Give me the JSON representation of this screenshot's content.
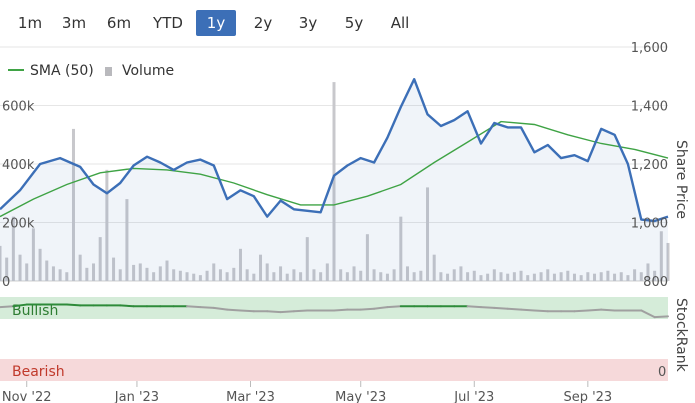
{
  "range_selector": {
    "buttons": [
      "1m",
      "3m",
      "6m",
      "YTD",
      "1y",
      "2y",
      "3y",
      "5y",
      "All"
    ],
    "active": "1y"
  },
  "legend": {
    "sma_label": "SMA (50)",
    "volume_label": "Volume"
  },
  "side_labels": {
    "price_axis": "Share Price",
    "rank_axis": "StockRank"
  },
  "zones": {
    "bullish": "Bullish",
    "bearish": "Bearish",
    "rank_zero": "0"
  },
  "colors": {
    "price_line": "#3c6fb7",
    "sma_line": "#3fa345",
    "volume_bar": "#c8c8cc",
    "bullish_fill": "#d5ecd9",
    "bearish_fill": "#f6d9da",
    "rank_bullish_line": "#2e8b3a",
    "rank_neutral_line": "#a0a0a0",
    "active_button": "#3c6fb7"
  },
  "chart_data": [
    {
      "type": "line",
      "x_ticks": [
        "Nov '22",
        "Jan '23",
        "Mar '23",
        "May '23",
        "Jul '23",
        "Sep '23"
      ],
      "price_axis": {
        "ticks": [
          "800",
          "1,000",
          "1,200",
          "1,400",
          "1,600"
        ],
        "ylim": [
          800,
          1600
        ]
      },
      "volume_axis": {
        "ticks": [
          "0",
          "200k",
          "400k",
          "600k"
        ],
        "ylim": [
          0,
          800000
        ]
      },
      "series": [
        {
          "name": "Share Price",
          "x": [
            0,
            3,
            6,
            9,
            12,
            14,
            16,
            18,
            20,
            22,
            24,
            26,
            28,
            30,
            32,
            34,
            36,
            38,
            40,
            42,
            44,
            46,
            48,
            50,
            52,
            54,
            56,
            58,
            60,
            62,
            64,
            66,
            68,
            70,
            72,
            74,
            76,
            78,
            80,
            82,
            84,
            86,
            88,
            90,
            92,
            94,
            96,
            98,
            100
          ],
          "values": [
            1045,
            1110,
            1200,
            1220,
            1190,
            1130,
            1100,
            1135,
            1195,
            1225,
            1205,
            1180,
            1205,
            1215,
            1195,
            1080,
            1110,
            1090,
            1020,
            1075,
            1045,
            1040,
            1035,
            1160,
            1195,
            1220,
            1205,
            1290,
            1395,
            1490,
            1370,
            1330,
            1350,
            1380,
            1270,
            1340,
            1325,
            1325,
            1240,
            1265,
            1220,
            1230,
            1210,
            1320,
            1300,
            1200,
            1010,
            1005,
            1020
          ]
        },
        {
          "name": "SMA (50)",
          "x": [
            0,
            5,
            10,
            15,
            20,
            25,
            30,
            35,
            40,
            45,
            50,
            55,
            60,
            65,
            70,
            75,
            80,
            85,
            90,
            95,
            100
          ],
          "values": [
            1020,
            1080,
            1130,
            1170,
            1185,
            1180,
            1165,
            1135,
            1095,
            1060,
            1060,
            1090,
            1130,
            1205,
            1275,
            1345,
            1335,
            1300,
            1270,
            1250,
            1220
          ]
        },
        {
          "name": "Volume",
          "x": [
            0,
            1,
            2,
            3,
            4,
            5,
            6,
            7,
            8,
            9,
            10,
            11,
            12,
            13,
            14,
            15,
            16,
            17,
            18,
            19,
            20,
            21,
            22,
            23,
            24,
            25,
            26,
            27,
            28,
            29,
            30,
            31,
            32,
            33,
            34,
            35,
            36,
            37,
            38,
            39,
            40,
            41,
            42,
            43,
            44,
            45,
            46,
            47,
            48,
            49,
            50,
            51,
            52,
            53,
            54,
            55,
            56,
            57,
            58,
            59,
            60,
            61,
            62,
            63,
            64,
            65,
            66,
            67,
            68,
            69,
            70,
            71,
            72,
            73,
            74,
            75,
            76,
            77,
            78,
            79,
            80,
            81,
            82,
            83,
            84,
            85,
            86,
            87,
            88,
            89,
            90,
            91,
            92,
            93,
            94,
            95,
            96,
            97,
            98,
            99,
            100
          ],
          "values": [
            120000,
            80000,
            220000,
            90000,
            60000,
            180000,
            110000,
            70000,
            50000,
            40000,
            30000,
            520000,
            90000,
            45000,
            60000,
            150000,
            380000,
            80000,
            40000,
            280000,
            55000,
            60000,
            45000,
            30000,
            50000,
            70000,
            40000,
            35000,
            30000,
            25000,
            20000,
            35000,
            60000,
            40000,
            30000,
            45000,
            110000,
            40000,
            25000,
            90000,
            60000,
            30000,
            50000,
            25000,
            40000,
            30000,
            150000,
            40000,
            30000,
            60000,
            680000,
            40000,
            30000,
            50000,
            35000,
            160000,
            40000,
            30000,
            25000,
            40000,
            220000,
            50000,
            30000,
            35000,
            320000,
            90000,
            30000,
            25000,
            40000,
            50000,
            30000,
            35000,
            20000,
            25000,
            40000,
            30000,
            25000,
            30000,
            35000,
            20000,
            25000,
            30000,
            40000,
            25000,
            30000,
            35000,
            25000,
            20000,
            30000,
            25000,
            30000,
            35000,
            25000,
            30000,
            20000,
            40000,
            30000,
            60000,
            35000,
            170000,
            130000
          ]
        }
      ]
    },
    {
      "type": "line",
      "title": "StockRank",
      "zones": [
        "Bullish",
        "Bearish"
      ],
      "ylim": [
        0,
        100
      ],
      "series": [
        {
          "name": "StockRank",
          "x": [
            0,
            2,
            4,
            6,
            8,
            10,
            12,
            14,
            16,
            18,
            20,
            22,
            24,
            26,
            28,
            30,
            32,
            34,
            36,
            38,
            40,
            42,
            44,
            46,
            48,
            50,
            52,
            54,
            56,
            58,
            60,
            62,
            64,
            66,
            68,
            70,
            72,
            74,
            76,
            78,
            80,
            82,
            84,
            86,
            88,
            90,
            92,
            94,
            96,
            98,
            100
          ],
          "values": [
            88,
            89,
            91,
            91,
            91,
            91,
            90,
            90,
            90,
            90,
            89,
            89,
            89,
            89,
            89,
            88,
            87,
            85,
            84,
            83,
            83,
            82,
            83,
            84,
            84,
            84,
            85,
            85,
            86,
            88,
            89,
            89,
            89,
            89,
            89,
            89,
            88,
            87,
            86,
            85,
            84,
            83,
            83,
            83,
            84,
            85,
            84,
            84,
            84,
            76,
            77
          ]
        }
      ]
    }
  ]
}
